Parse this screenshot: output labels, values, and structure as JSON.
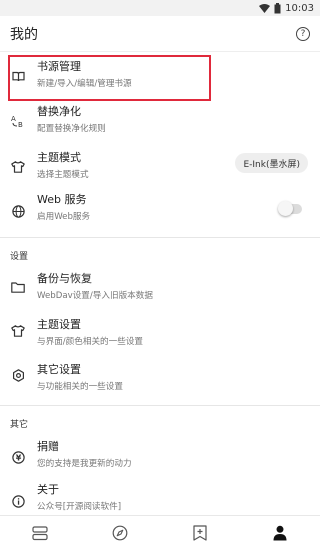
{
  "status_bar": {
    "time": "10:03"
  },
  "app_bar": {
    "title": "我的"
  },
  "main_items": [
    {
      "title": "书源管理",
      "subtitle": "新建/导入/编辑/管理书源"
    },
    {
      "title": "替换净化",
      "subtitle": "配置替换净化规则"
    },
    {
      "title": "主题模式",
      "subtitle": "选择主题模式",
      "value": "E-Ink(墨水屏)"
    },
    {
      "title": "Web 服务",
      "subtitle": "启用Web服务",
      "toggle_on": false
    }
  ],
  "settings_section": {
    "header": "设置",
    "items": [
      {
        "title": "备份与恢复",
        "subtitle": "WebDav设置/导入旧版本数据"
      },
      {
        "title": "主题设置",
        "subtitle": "与界面/颜色相关的一些设置"
      },
      {
        "title": "其它设置",
        "subtitle": "与功能相关的一些设置"
      }
    ]
  },
  "other_section": {
    "header": "其它",
    "items": [
      {
        "title": "捐赠",
        "subtitle": "您的支持是我更新的动力"
      },
      {
        "title": "关于",
        "subtitle": "公众号[开源阅读软件]"
      }
    ]
  },
  "bottom_nav": [
    "bookshelf-icon",
    "explore-icon",
    "rss-bookmark-icon",
    "my-profile-icon"
  ],
  "colors": {
    "highlight": "#e0293b",
    "text": "#222222",
    "subtext": "#777777"
  }
}
